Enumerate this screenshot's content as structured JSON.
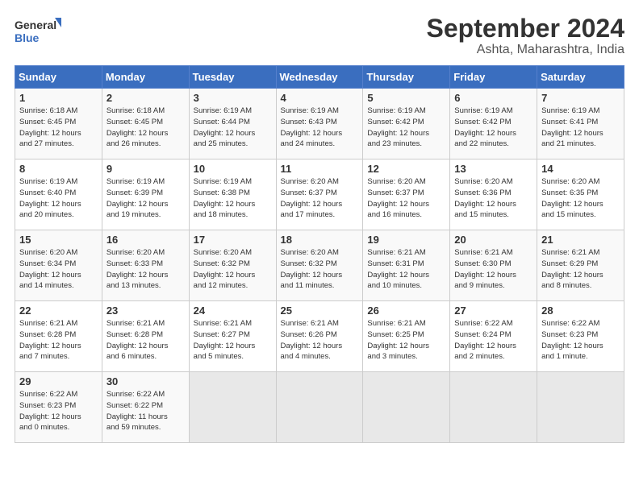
{
  "logo": {
    "line1": "General",
    "line2": "Blue"
  },
  "title": "September 2024",
  "subtitle": "Ashta, Maharashtra, India",
  "days_header": [
    "Sunday",
    "Monday",
    "Tuesday",
    "Wednesday",
    "Thursday",
    "Friday",
    "Saturday"
  ],
  "weeks": [
    [
      {
        "num": "1",
        "info": "Sunrise: 6:18 AM\nSunset: 6:45 PM\nDaylight: 12 hours\nand 27 minutes."
      },
      {
        "num": "2",
        "info": "Sunrise: 6:18 AM\nSunset: 6:45 PM\nDaylight: 12 hours\nand 26 minutes."
      },
      {
        "num": "3",
        "info": "Sunrise: 6:19 AM\nSunset: 6:44 PM\nDaylight: 12 hours\nand 25 minutes."
      },
      {
        "num": "4",
        "info": "Sunrise: 6:19 AM\nSunset: 6:43 PM\nDaylight: 12 hours\nand 24 minutes."
      },
      {
        "num": "5",
        "info": "Sunrise: 6:19 AM\nSunset: 6:42 PM\nDaylight: 12 hours\nand 23 minutes."
      },
      {
        "num": "6",
        "info": "Sunrise: 6:19 AM\nSunset: 6:42 PM\nDaylight: 12 hours\nand 22 minutes."
      },
      {
        "num": "7",
        "info": "Sunrise: 6:19 AM\nSunset: 6:41 PM\nDaylight: 12 hours\nand 21 minutes."
      }
    ],
    [
      {
        "num": "8",
        "info": "Sunrise: 6:19 AM\nSunset: 6:40 PM\nDaylight: 12 hours\nand 20 minutes."
      },
      {
        "num": "9",
        "info": "Sunrise: 6:19 AM\nSunset: 6:39 PM\nDaylight: 12 hours\nand 19 minutes."
      },
      {
        "num": "10",
        "info": "Sunrise: 6:19 AM\nSunset: 6:38 PM\nDaylight: 12 hours\nand 18 minutes."
      },
      {
        "num": "11",
        "info": "Sunrise: 6:20 AM\nSunset: 6:37 PM\nDaylight: 12 hours\nand 17 minutes."
      },
      {
        "num": "12",
        "info": "Sunrise: 6:20 AM\nSunset: 6:37 PM\nDaylight: 12 hours\nand 16 minutes."
      },
      {
        "num": "13",
        "info": "Sunrise: 6:20 AM\nSunset: 6:36 PM\nDaylight: 12 hours\nand 15 minutes."
      },
      {
        "num": "14",
        "info": "Sunrise: 6:20 AM\nSunset: 6:35 PM\nDaylight: 12 hours\nand 15 minutes."
      }
    ],
    [
      {
        "num": "15",
        "info": "Sunrise: 6:20 AM\nSunset: 6:34 PM\nDaylight: 12 hours\nand 14 minutes."
      },
      {
        "num": "16",
        "info": "Sunrise: 6:20 AM\nSunset: 6:33 PM\nDaylight: 12 hours\nand 13 minutes."
      },
      {
        "num": "17",
        "info": "Sunrise: 6:20 AM\nSunset: 6:32 PM\nDaylight: 12 hours\nand 12 minutes."
      },
      {
        "num": "18",
        "info": "Sunrise: 6:20 AM\nSunset: 6:32 PM\nDaylight: 12 hours\nand 11 minutes."
      },
      {
        "num": "19",
        "info": "Sunrise: 6:21 AM\nSunset: 6:31 PM\nDaylight: 12 hours\nand 10 minutes."
      },
      {
        "num": "20",
        "info": "Sunrise: 6:21 AM\nSunset: 6:30 PM\nDaylight: 12 hours\nand 9 minutes."
      },
      {
        "num": "21",
        "info": "Sunrise: 6:21 AM\nSunset: 6:29 PM\nDaylight: 12 hours\nand 8 minutes."
      }
    ],
    [
      {
        "num": "22",
        "info": "Sunrise: 6:21 AM\nSunset: 6:28 PM\nDaylight: 12 hours\nand 7 minutes."
      },
      {
        "num": "23",
        "info": "Sunrise: 6:21 AM\nSunset: 6:28 PM\nDaylight: 12 hours\nand 6 minutes."
      },
      {
        "num": "24",
        "info": "Sunrise: 6:21 AM\nSunset: 6:27 PM\nDaylight: 12 hours\nand 5 minutes."
      },
      {
        "num": "25",
        "info": "Sunrise: 6:21 AM\nSunset: 6:26 PM\nDaylight: 12 hours\nand 4 minutes."
      },
      {
        "num": "26",
        "info": "Sunrise: 6:21 AM\nSunset: 6:25 PM\nDaylight: 12 hours\nand 3 minutes."
      },
      {
        "num": "27",
        "info": "Sunrise: 6:22 AM\nSunset: 6:24 PM\nDaylight: 12 hours\nand 2 minutes."
      },
      {
        "num": "28",
        "info": "Sunrise: 6:22 AM\nSunset: 6:23 PM\nDaylight: 12 hours\nand 1 minute."
      }
    ],
    [
      {
        "num": "29",
        "info": "Sunrise: 6:22 AM\nSunset: 6:23 PM\nDaylight: 12 hours\nand 0 minutes."
      },
      {
        "num": "30",
        "info": "Sunrise: 6:22 AM\nSunset: 6:22 PM\nDaylight: 11 hours\nand 59 minutes."
      },
      {
        "num": "",
        "info": ""
      },
      {
        "num": "",
        "info": ""
      },
      {
        "num": "",
        "info": ""
      },
      {
        "num": "",
        "info": ""
      },
      {
        "num": "",
        "info": ""
      }
    ]
  ]
}
